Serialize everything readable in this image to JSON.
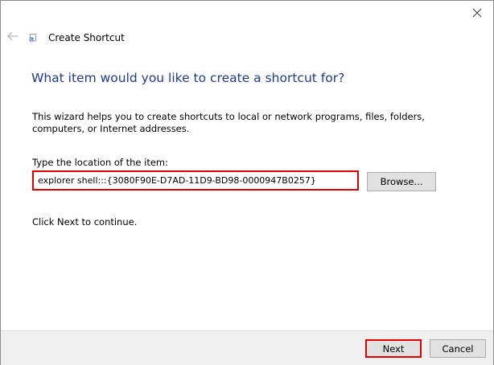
{
  "window": {
    "title": "Create Shortcut"
  },
  "icons": {
    "close": "close-icon",
    "back": "back-arrow-icon",
    "title": "shortcut-icon"
  },
  "main": {
    "heading": "What item would you like to create a shortcut for?",
    "description": "This wizard helps you to create shortcuts to local or network programs, files, folders, computers, or Internet addresses.",
    "location_label": "Type the location of the item:",
    "location_value": "explorer shell:::{3080F90E-D7AD-11D9-BD98-0000947B0257}",
    "browse_label": "Browse...",
    "continue_text": "Click Next to continue."
  },
  "footer": {
    "next_label": "Next",
    "cancel_label": "Cancel"
  },
  "colors": {
    "heading": "#1e3a8c",
    "highlight": "#e00000",
    "button_bg": "#e1e1e1",
    "footer_bg": "#f0f0f0"
  }
}
